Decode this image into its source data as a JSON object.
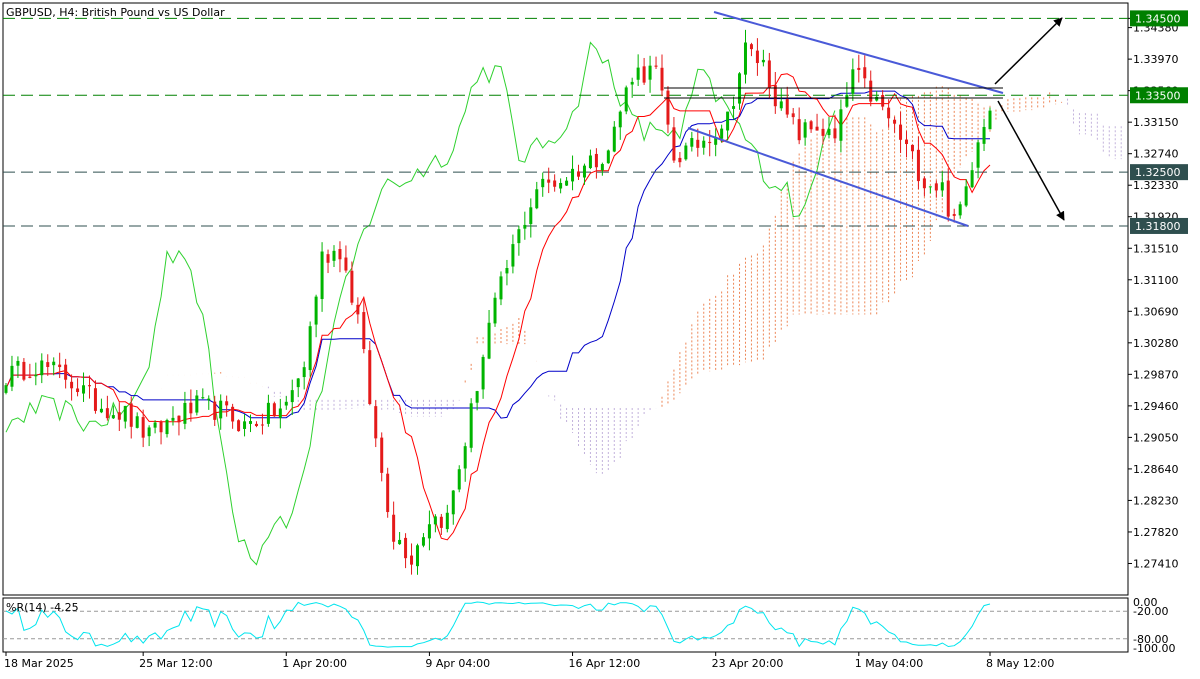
{
  "chart_data": [
    {
      "type": "candlestick",
      "title": "GBPUSD, H4:  British Pound vs US Dollar",
      "symbol": "GBPUSD",
      "timeframe": "H4",
      "instrument_name": "British Pound vs US Dollar",
      "ylim": [
        1.27,
        1.347
      ],
      "y_ticks": [
        "1.34500",
        "1.34380",
        "1.33970",
        "1.33560",
        "1.33150",
        "1.32740",
        "1.32330",
        "1.31920",
        "1.31510",
        "1.31100",
        "1.30690",
        "1.30280",
        "1.29870",
        "1.29460",
        "1.29050",
        "1.28640",
        "1.28230",
        "1.27820",
        "1.27410"
      ],
      "x_ticks": [
        "18 Mar 2025",
        "25 Mar 12:00",
        "1 Apr 20:00",
        "9 Apr 04:00",
        "16 Apr 12:00",
        "23 Apr 20:00",
        "1 May 04:00",
        "8 May 12:00"
      ],
      "horizontal_levels": [
        {
          "value": 1.345,
          "label": "1.34500",
          "color": "#008000"
        },
        {
          "value": 1.335,
          "label": "1.33500",
          "color": "#008000"
        },
        {
          "value": 1.325,
          "label": "1.32500",
          "color": "#2f4f4f"
        },
        {
          "value": 1.318,
          "label": "1.31800",
          "color": "#2f4f4f"
        }
      ],
      "indicators": [
        "Ichimoku Kinko Hyo"
      ],
      "colors": {
        "bull": "#00b400",
        "bear": "#e41a1a",
        "tenkan": "#ff0000",
        "kijun": "#0000c8",
        "chikou": "#2fd12f",
        "cloud": "#e9723a",
        "trendline": "#4a5ad8",
        "arrow": "#000000"
      },
      "anchors": [
        [
          0,
          1.2985
        ],
        [
          5,
          1.3
        ],
        [
          10,
          1.2985
        ],
        [
          15,
          1.295
        ],
        [
          20,
          1.2935
        ],
        [
          24,
          1.2905
        ],
        [
          28,
          1.293
        ],
        [
          32,
          1.2945
        ],
        [
          36,
          1.294
        ],
        [
          40,
          1.292
        ],
        [
          44,
          1.2935
        ],
        [
          47,
          1.2945
        ],
        [
          50,
          1.3
        ],
        [
          53,
          1.314
        ],
        [
          56,
          1.315
        ],
        [
          59,
          1.306
        ],
        [
          62,
          1.29
        ],
        [
          65,
          1.278
        ],
        [
          68,
          1.275
        ],
        [
          71,
          1.28
        ],
        [
          74,
          1.28
        ],
        [
          77,
          1.29
        ],
        [
          81,
          1.305
        ],
        [
          85,
          1.315
        ],
        [
          89,
          1.323
        ],
        [
          93,
          1.324
        ],
        [
          97,
          1.326
        ],
        [
          101,
          1.328
        ],
        [
          105,
          1.338
        ],
        [
          109,
          1.338
        ],
        [
          112,
          1.327
        ],
        [
          115,
          1.328
        ],
        [
          118,
          1.33
        ],
        [
          121,
          1.332
        ],
        [
          124,
          1.341
        ],
        [
          127,
          1.339
        ],
        [
          130,
          1.333
        ],
        [
          133,
          1.33
        ],
        [
          136,
          1.331
        ],
        [
          139,
          1.329
        ],
        [
          142,
          1.338
        ],
        [
          145,
          1.335
        ],
        [
          148,
          1.332
        ],
        [
          151,
          1.328
        ],
        [
          154,
          1.324
        ],
        [
          157,
          1.323
        ],
        [
          159,
          1.318
        ],
        [
          161,
          1.323
        ],
        [
          163,
          1.33
        ],
        [
          165,
          1.333
        ]
      ]
    },
    {
      "type": "line",
      "title": "%R(14) -4.25",
      "indicator": "Williams %R",
      "period": 14,
      "last_value": -4.25,
      "ylim": [
        -100,
        0
      ],
      "y_ticks": [
        "0.00",
        "-20.00",
        "-80.00",
        "-100.00"
      ],
      "levels": [
        -20,
        -80
      ],
      "color": "#00e5ee"
    }
  ]
}
